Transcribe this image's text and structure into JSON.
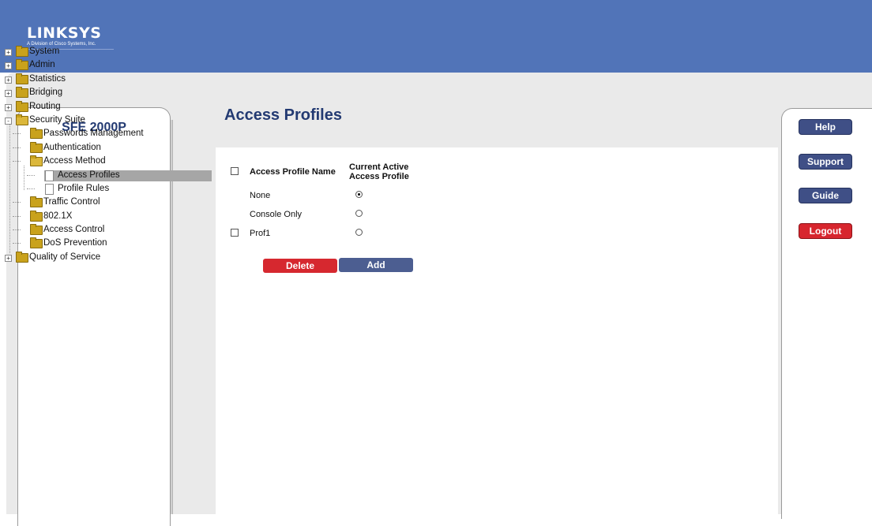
{
  "header": {
    "brand": "LINKSYS",
    "tagline": "A Division of Cisco Systems, Inc."
  },
  "sidebar": {
    "model": "SFE 2000P",
    "tree": [
      {
        "label": "System",
        "level": 0,
        "type": "folder",
        "expander": "+"
      },
      {
        "label": "Admin",
        "level": 0,
        "type": "folder",
        "expander": "+"
      },
      {
        "label": "Statistics",
        "level": 0,
        "type": "folder",
        "expander": "+"
      },
      {
        "label": "Bridging",
        "level": 0,
        "type": "folder",
        "expander": "+"
      },
      {
        "label": "Routing",
        "level": 0,
        "type": "folder",
        "expander": "+"
      },
      {
        "label": "Security Suite",
        "level": 0,
        "type": "folder-open",
        "expander": "-"
      },
      {
        "label": "Passwords Management",
        "level": 1,
        "type": "folder"
      },
      {
        "label": "Authentication",
        "level": 1,
        "type": "folder"
      },
      {
        "label": "Access Method",
        "level": 1,
        "type": "folder-open"
      },
      {
        "label": "Access Profiles",
        "level": 2,
        "type": "page",
        "selected": true
      },
      {
        "label": "Profile Rules",
        "level": 2,
        "type": "page"
      },
      {
        "label": "Traffic Control",
        "level": 1,
        "type": "folder"
      },
      {
        "label": "802.1X",
        "level": 1,
        "type": "folder"
      },
      {
        "label": "Access Control",
        "level": 1,
        "type": "folder"
      },
      {
        "label": "DoS Prevention",
        "level": 1,
        "type": "folder"
      },
      {
        "label": "Quality of Service",
        "level": 0,
        "type": "folder",
        "expander": "+"
      }
    ]
  },
  "main": {
    "title": "Access Profiles",
    "table": {
      "col_name": "Access Profile Name",
      "col_active_line1": "Current Active",
      "col_active_line2": "Access Profile",
      "rows": [
        {
          "name": "None",
          "checkbox": false,
          "active": true
        },
        {
          "name": "Console Only",
          "checkbox": false,
          "active": false
        },
        {
          "name": "Prof1",
          "checkbox": true,
          "active": false
        }
      ]
    },
    "delete_label": "Delete",
    "add_label": "Add"
  },
  "right": {
    "help": "Help",
    "support": "Support",
    "guide": "Guide",
    "logout": "Logout"
  },
  "colors": {
    "header": "#5174b8",
    "title": "#233a72",
    "delete": "#d6282f",
    "add": "#4c5e91",
    "logout": "#d7262e"
  }
}
